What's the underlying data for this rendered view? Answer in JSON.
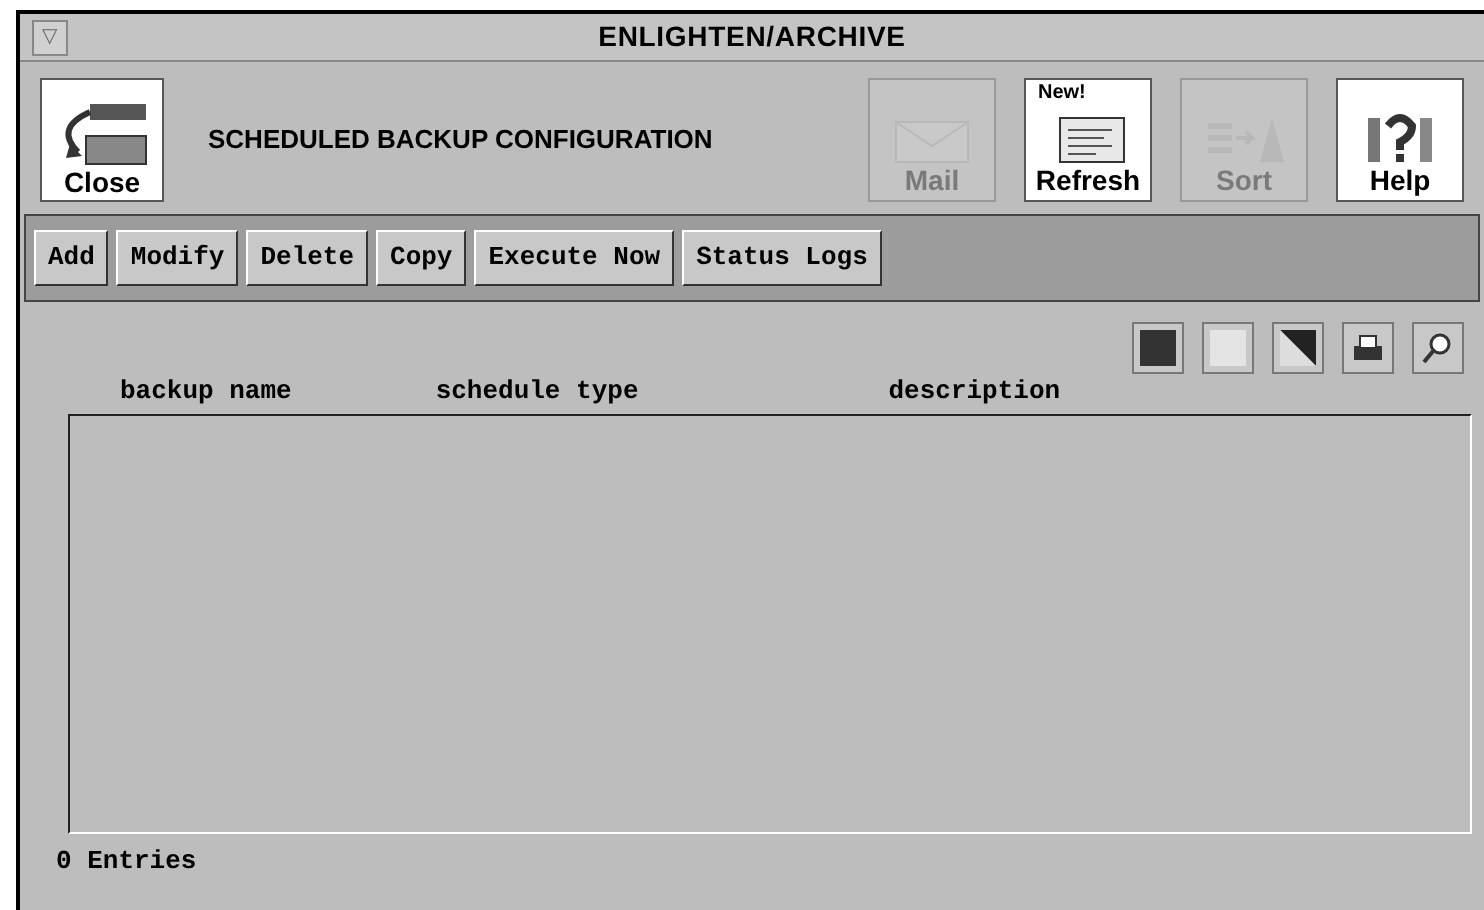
{
  "window": {
    "title": "ENLIGHTEN/ARCHIVE",
    "menu_glyph": "▽"
  },
  "header": {
    "close_label": "Close",
    "heading": "SCHEDULED BACKUP CONFIGURATION",
    "tools": [
      {
        "kind": "mail",
        "label": "Mail",
        "disabled": true
      },
      {
        "kind": "refresh",
        "label": "Refresh",
        "disabled": false,
        "badge": "New!"
      },
      {
        "kind": "sort",
        "label": "Sort",
        "disabled": true
      },
      {
        "kind": "help",
        "label": "Help",
        "disabled": false
      }
    ]
  },
  "actions": [
    "Add",
    "Modify",
    "Delete",
    "Copy",
    "Execute Now",
    "Status Logs"
  ],
  "view_tools": [
    {
      "kind": "dark"
    },
    {
      "kind": "light"
    },
    {
      "kind": "contrast"
    },
    {
      "kind": "print"
    },
    {
      "kind": "zoom"
    }
  ],
  "table": {
    "columns": [
      "backup name",
      "schedule type",
      "description"
    ]
  },
  "status_bar": "0 Entries"
}
